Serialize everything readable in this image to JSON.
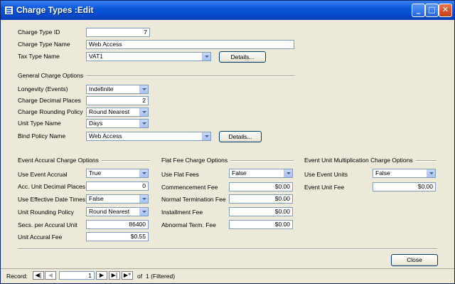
{
  "window": {
    "title": "Charge Types :Edit"
  },
  "title_buttons": {
    "minimize": "_",
    "maximize": "□",
    "close": "✕"
  },
  "header": {
    "charge_type_id": {
      "label": "Charge Type ID",
      "value": "7"
    },
    "charge_type_name": {
      "label": "Charge Type Name",
      "value": "Web Access"
    },
    "tax_type_name": {
      "label": "Tax Type Name",
      "value": "VAT1"
    },
    "details_label": "Details..."
  },
  "general": {
    "section_title": "General Charge Options",
    "longevity": {
      "label": "Longevity (Events)",
      "value": "Indefinite"
    },
    "decimal_places": {
      "label": "Charge Decimal Places",
      "value": "2"
    },
    "rounding_policy": {
      "label": "Charge Rounding Policy",
      "value": "Round Nearest"
    },
    "unit_type": {
      "label": "Unit Type Name",
      "value": "Days"
    },
    "bind_policy": {
      "label": "Bind Policy Name",
      "value": "Web Access"
    },
    "details_label": "Details..."
  },
  "event_accrual": {
    "section_title": "Event Accural Charge Options",
    "use_event_accrual": {
      "label": "Use Event Accrual",
      "value": "True"
    },
    "unit_decimal_places": {
      "label": "Acc. Unit Decimal Places",
      "value": "0"
    },
    "use_effective_dates": {
      "label": "Use Effective Date Times",
      "value": "False"
    },
    "unit_rounding_policy": {
      "label": "Unit Rounding Policy",
      "value": "Round Nearest"
    },
    "secs_per_unit": {
      "label": "Secs. per Accural Unit",
      "value": "86400"
    },
    "unit_accrual_fee": {
      "label": "Unit Accural Fee",
      "value": "$0.55"
    }
  },
  "flat_fee": {
    "section_title": "Flat Fee Charge Options",
    "use_flat_fees": {
      "label": "Use Flat Fees",
      "value": "False"
    },
    "commencement_fee": {
      "label": "Commencement Fee",
      "value": "$0.00"
    },
    "normal_termination_fee": {
      "label": "Normal Termination Fee",
      "value": "$0.00"
    },
    "installment_fee": {
      "label": "Installment Fee",
      "value": "$0.00"
    },
    "abnormal_term_fee": {
      "label": "Abnormal Term. Fee",
      "value": "$0.00"
    }
  },
  "event_unit": {
    "section_title": "Event Unit Multiplication Charge Options",
    "use_event_units": {
      "label": "Use Event Units",
      "value": "False"
    },
    "event_unit_fee": {
      "label": "Event Unit Fee",
      "value": "$0.00"
    }
  },
  "footer": {
    "close_label": "Close"
  },
  "navigation": {
    "record_label": "Record:",
    "current_record": "1",
    "of_label": "of",
    "total_records": "1 (Filtered)",
    "first_icon": "first-record-icon",
    "prev_icon": "previous-record-icon",
    "next_icon": "next-record-icon",
    "last_icon": "last-record-icon",
    "new_icon": "new-record-icon"
  },
  "colors": {
    "titlebar": "#0a58d8",
    "window_bg": "#ece9d8",
    "field_border": "#7f9db9"
  }
}
